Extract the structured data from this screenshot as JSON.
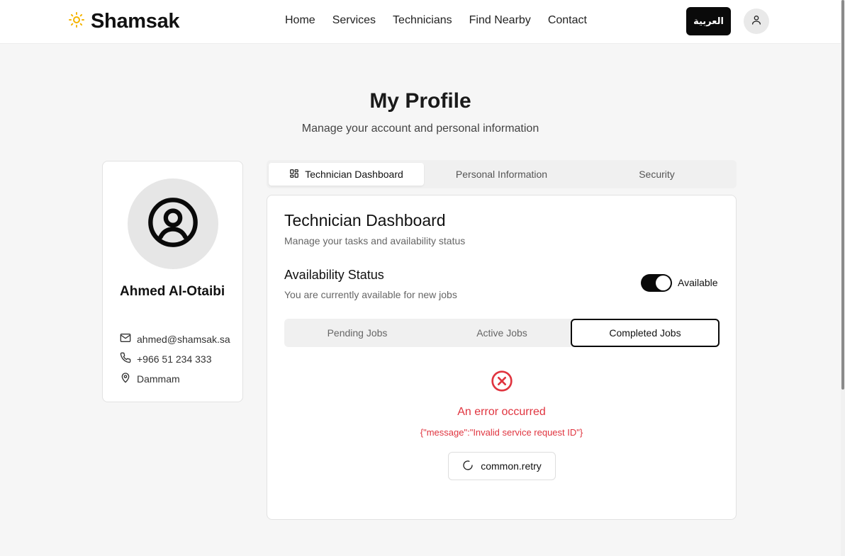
{
  "header": {
    "logo_text": "Shamsak",
    "nav": [
      "Home",
      "Services",
      "Technicians",
      "Find Nearby",
      "Contact"
    ],
    "lang_button": "العربية"
  },
  "page": {
    "title": "My Profile",
    "subtitle": "Manage your account and personal information"
  },
  "profile": {
    "name": "Ahmed Al-Otaibi",
    "email": "ahmed@shamsak.sa",
    "phone": "+966 51 234 333",
    "city": "Dammam"
  },
  "tabs": [
    "Technician Dashboard",
    "Personal Information",
    "Security"
  ],
  "dashboard": {
    "title": "Technician Dashboard",
    "subtitle": "Manage your tasks and availability status",
    "availability_title": "Availability Status",
    "availability_sub": "You are currently available for new jobs",
    "toggle_label": "Available",
    "job_tabs": [
      "Pending Jobs",
      "Active Jobs",
      "Completed Jobs"
    ],
    "error_title": "An error occurred",
    "error_message": "{\"message\":\"Invalid service request ID\"}",
    "retry_label": "common.retry"
  },
  "colors": {
    "accent": "#f5b400",
    "error": "#e0343f",
    "primary": "#0a0a0a"
  }
}
